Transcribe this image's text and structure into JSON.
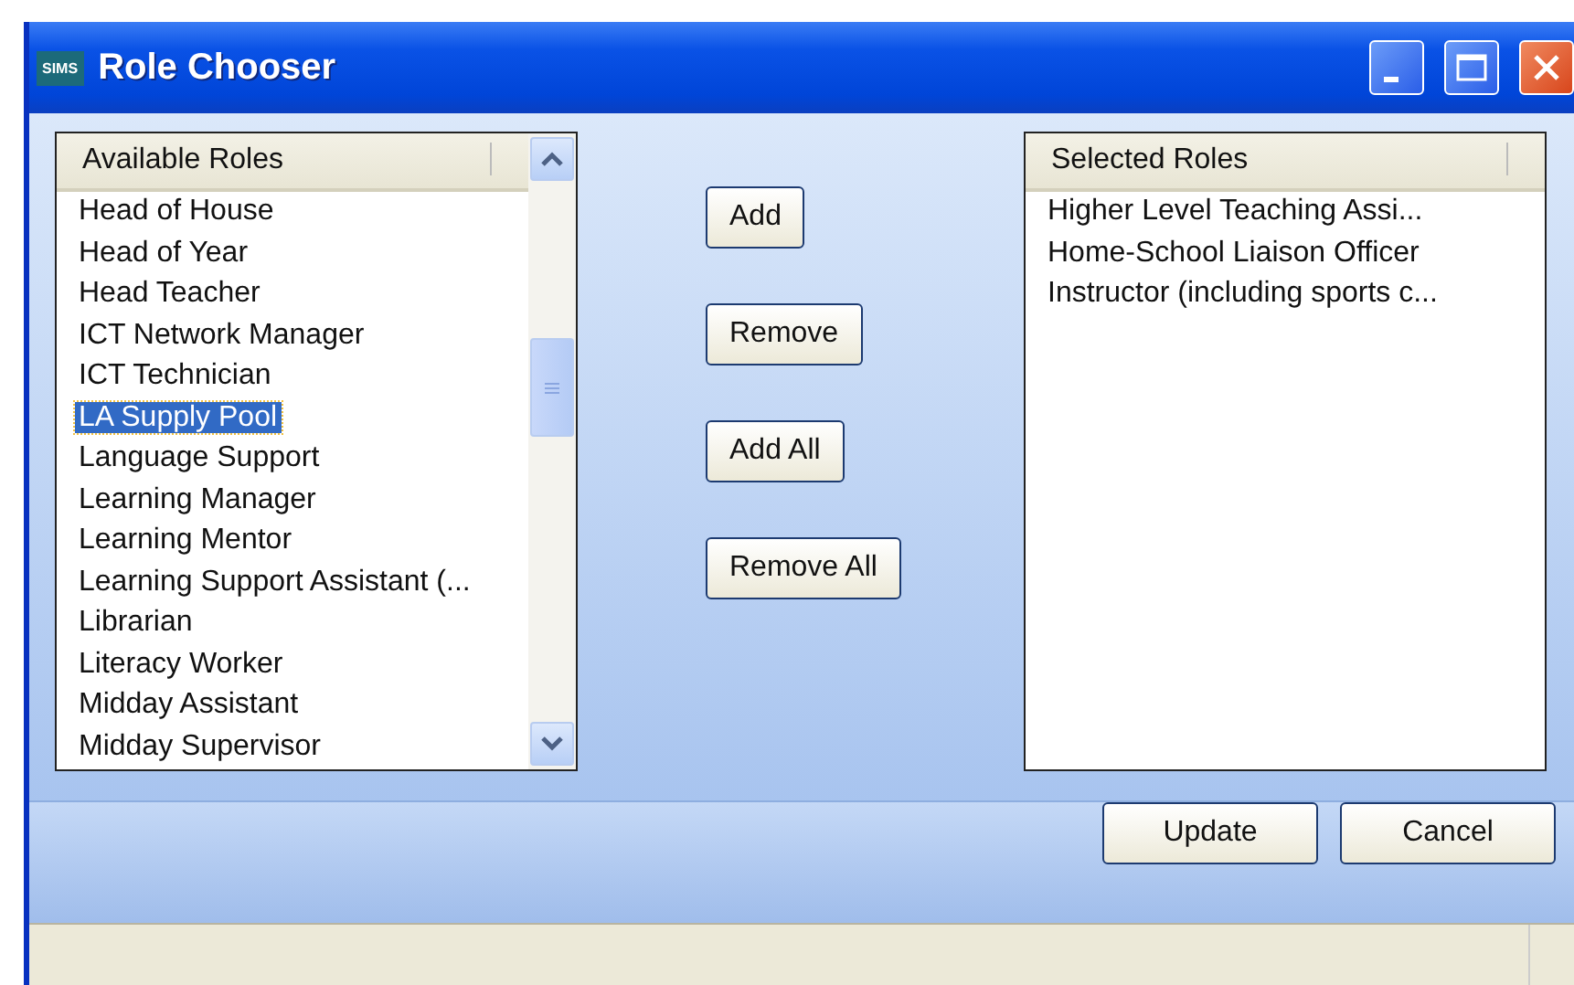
{
  "window": {
    "logo": "SIMS",
    "title": "Role Chooser"
  },
  "available_roles": {
    "header": "Available Roles",
    "items": [
      {
        "label": "Head of House",
        "selected": false
      },
      {
        "label": "Head of Year",
        "selected": false
      },
      {
        "label": "Head Teacher",
        "selected": false
      },
      {
        "label": "ICT Network Manager",
        "selected": false
      },
      {
        "label": "ICT Technician",
        "selected": false
      },
      {
        "label": "LA Supply Pool",
        "selected": true
      },
      {
        "label": "Language Support",
        "selected": false
      },
      {
        "label": "Learning Manager",
        "selected": false
      },
      {
        "label": "Learning Mentor",
        "selected": false
      },
      {
        "label": "Learning Support Assistant (...",
        "selected": false
      },
      {
        "label": "Librarian",
        "selected": false
      },
      {
        "label": "Literacy Worker",
        "selected": false
      },
      {
        "label": "Midday Assistant",
        "selected": false
      },
      {
        "label": "Midday Supervisor",
        "selected": false
      }
    ]
  },
  "transfer_buttons": [
    "Add",
    "Remove",
    "Add All",
    "Remove All"
  ],
  "selected_roles": {
    "header": "Selected Roles",
    "items": [
      {
        "label": "Higher Level Teaching Assi...",
        "selected": false
      },
      {
        "label": "Home-School Liaison Officer",
        "selected": false
      },
      {
        "label": "Instructor (including sports c...",
        "selected": false
      }
    ]
  },
  "buttons": [
    "Update",
    "Cancel"
  ]
}
